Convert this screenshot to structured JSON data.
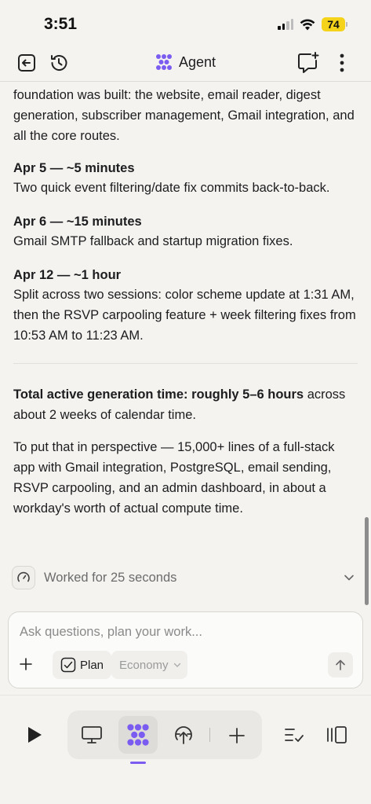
{
  "status": {
    "time": "3:51",
    "battery": "74"
  },
  "header": {
    "title": "Agent",
    "icons": [
      "exit-icon",
      "history-icon",
      "agent-logo-icon",
      "new-chat-icon",
      "more-icon"
    ]
  },
  "chat": {
    "intro_tail": "foundation was built: the website, email reader, digest generation, subscriber management, Gmail integration, and all the core routes.",
    "entries": [
      {
        "title": "Apr 5 — ~5 minutes",
        "body": "Two quick event filtering/date fix commits back-to-back."
      },
      {
        "title": "Apr 6 — ~15 minutes",
        "body": "Gmail SMTP fallback and startup migration fixes."
      },
      {
        "title": "Apr 12 — ~1 hour",
        "body": "Split across two sessions: color scheme update at 1:31 AM, then the RSVP carpooling feature + week filtering fixes from 10:53 AM to 11:23 AM."
      }
    ],
    "summary_bold": "Total active generation time: roughly 5–6 hours",
    "summary_rest": " across about 2 weeks of calendar time.",
    "perspective": "To put that in perspective — 15,000+ lines of a full-stack app with Gmail integration, PostgreSQL, email sending, RSVP carpooling, and an admin dashboard, in about a workday's worth of actual compute time.",
    "worked_for": "Worked for 25 seconds"
  },
  "composer": {
    "placeholder": "Ask questions, plan your work...",
    "value": "",
    "plan_label": "Plan",
    "plan_checked": true,
    "mode_label": "Economy"
  },
  "bottom_bar": {
    "icons": [
      "play-icon",
      "desktop-icon",
      "agent-logo-icon",
      "deploy-icon",
      "plus-icon",
      "tasks-icon",
      "panels-icon"
    ],
    "active": "agent-logo-icon"
  },
  "colors": {
    "accent": "#7b5cf0",
    "battery": "#f5d31a",
    "background": "#f4f3f0"
  }
}
